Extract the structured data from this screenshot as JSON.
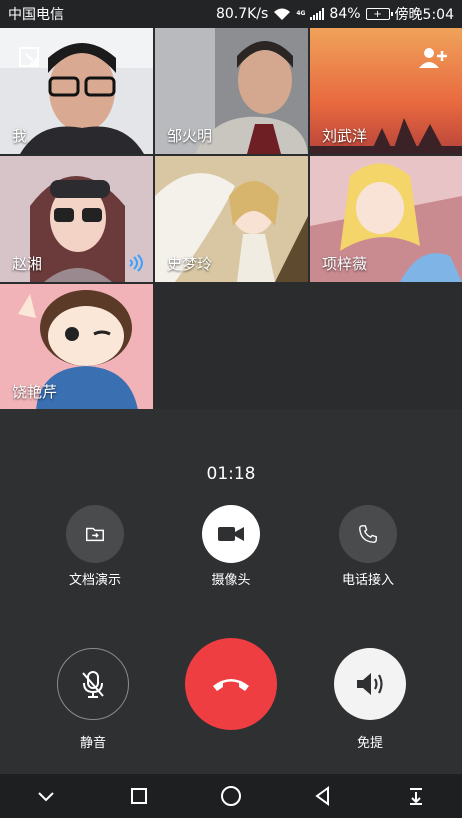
{
  "status_bar": {
    "carrier": "中国电信",
    "speed": "80.7K/s",
    "network": "4G",
    "battery": "84%",
    "time": "傍晚5:04"
  },
  "participants": [
    {
      "name": "我"
    },
    {
      "name": "邹火明"
    },
    {
      "name": "刘武洋"
    },
    {
      "name": "赵湘"
    },
    {
      "name": "史梦玲"
    },
    {
      "name": "项梓薇"
    },
    {
      "name": "饶艳芹"
    }
  ],
  "call": {
    "duration": "01:18",
    "actions": {
      "share_doc": "文档演示",
      "camera": "摄像头",
      "phone_in": "电话接入",
      "mute": "静音",
      "speaker": "免提"
    }
  },
  "colors": {
    "hangup": "#ef3e42",
    "panel": "#2f3032"
  }
}
